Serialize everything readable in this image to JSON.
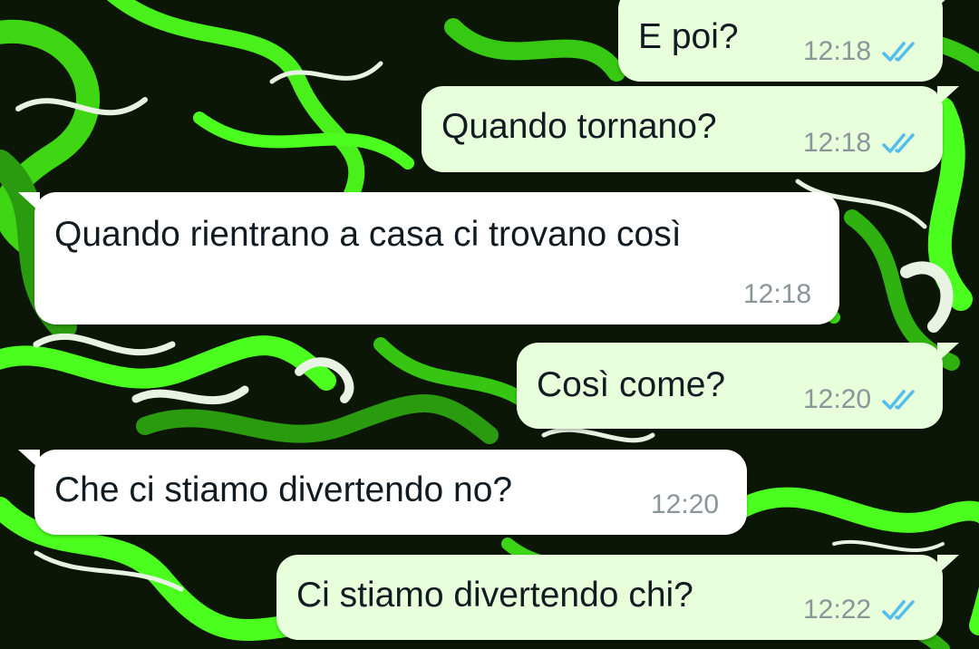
{
  "colors": {
    "outgoing_bubble": "#e7ffdb",
    "incoming_bubble": "#ffffff",
    "read_ticks": "#53bdeb",
    "time_text": "#8a9599",
    "wallpaper_dark": "#0a1a05",
    "wallpaper_green": "#4cff1f"
  },
  "messages": [
    {
      "direction": "outgoing",
      "text": "E poi?",
      "time": "12:18",
      "status_icon": "double-check-read-icon"
    },
    {
      "direction": "outgoing",
      "text": "Quando tornano?",
      "time": "12:18",
      "status_icon": "double-check-read-icon"
    },
    {
      "direction": "incoming",
      "text": "Quando rientrano a casa ci trovano così",
      "time": "12:18"
    },
    {
      "direction": "outgoing",
      "text": "Così come?",
      "time": "12:20",
      "status_icon": "double-check-read-icon"
    },
    {
      "direction": "incoming",
      "text": "Che ci stiamo divertendo no?",
      "time": "12:20"
    },
    {
      "direction": "outgoing",
      "text": "Ci stiamo divertendo chi?",
      "time": "12:22",
      "status_icon": "double-check-read-icon"
    }
  ]
}
